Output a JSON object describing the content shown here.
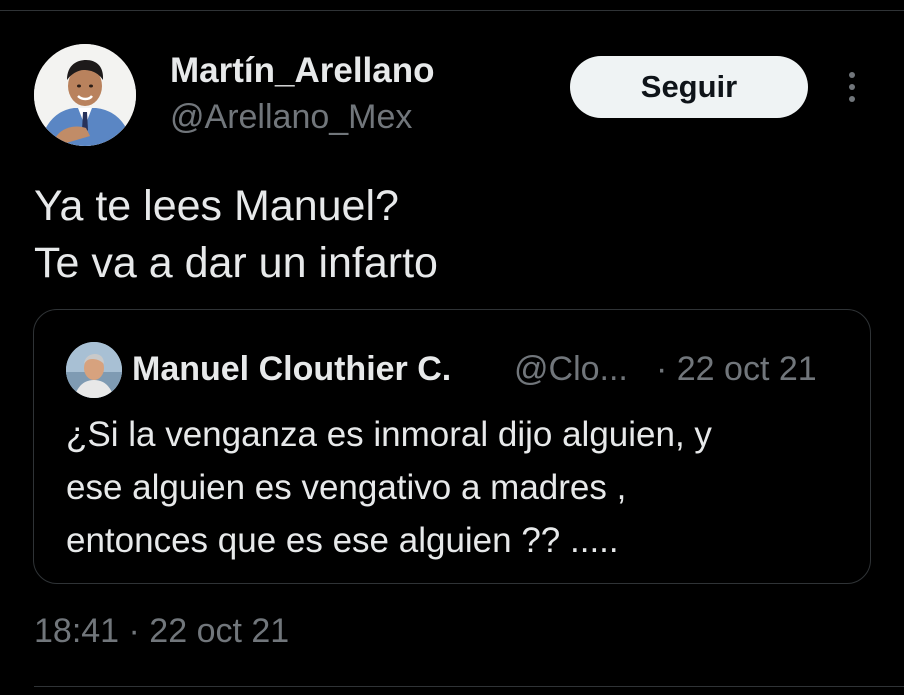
{
  "tweet": {
    "author": {
      "display_name": "Martín_Arellano",
      "handle": "@Arellano_Mex"
    },
    "follow_label": "Seguir",
    "text_lines": [
      "Ya te lees Manuel?",
      "Te va a dar un infarto"
    ],
    "timestamp": "18:41 · 22 oct 21"
  },
  "quoted": {
    "display_name": "Manuel Clouthier C.",
    "handle": "@Clo...",
    "date": "· 22 oct 21",
    "text_lines": [
      "¿Si la venganza es inmoral dijo alguien, y",
      "ese alguien es vengativo a madres ,",
      "entonces que es ese alguien ?? ....."
    ]
  },
  "icons": {
    "more": "more-dots-vertical-icon"
  },
  "colors": {
    "background": "#000000",
    "primary_text": "#e7e9ea",
    "secondary_text": "#71767b",
    "border": "#2f3336",
    "follow_button_bg": "#eff3f4"
  }
}
